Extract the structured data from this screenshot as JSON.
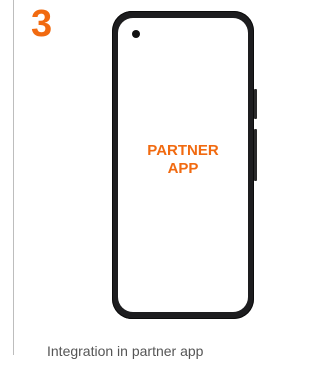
{
  "step": {
    "number": "3"
  },
  "phone": {
    "screen_label_line1": "PARTNER",
    "screen_label_line2": "APP"
  },
  "caption": "Integration in partner app",
  "colors": {
    "accent": "#f16a10",
    "divider": "#bdbdbd",
    "caption_text": "#555555",
    "phone_frame": "#1d1d1f"
  }
}
